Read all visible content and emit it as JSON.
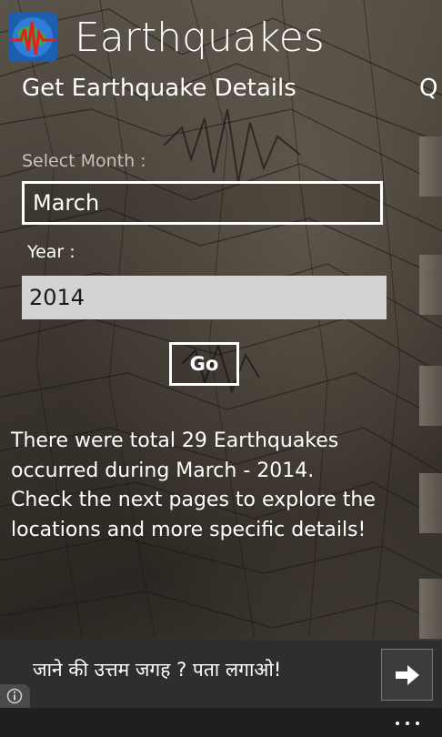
{
  "app": {
    "title": "Earthquakes",
    "logo_icon": "seismograph-globe-icon"
  },
  "pivot": {
    "current": "Get Earthquake Details",
    "next": "Q"
  },
  "form": {
    "month_label": "Select Month :",
    "month_value": "March",
    "year_label": "Year :",
    "year_value": "2014",
    "go_label": "Go"
  },
  "result": {
    "lines": [
      "There were total 29 Earthquakes",
      "occurred during March - 2014.",
      "Check the next pages to explore the",
      "locations and more specific details!"
    ]
  },
  "ad": {
    "text": "जाने की उत्तम जगह ? पता लगाओ!",
    "arrow_icon": "arrow-right-icon",
    "info_icon": "info-icon"
  },
  "appbar": {
    "more_icon": "more-ellipsis-icon"
  },
  "colors": {
    "accent": "#ffffff",
    "ad_background": "#2e2e2e",
    "year_field_background": "#d3d3d3"
  }
}
